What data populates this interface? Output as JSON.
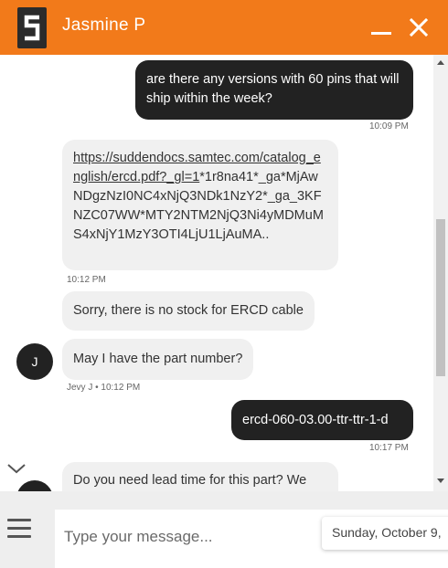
{
  "header": {
    "agent_name": "Jasmine P",
    "colors": {
      "brand": "#f27a1a",
      "logo": "#2b2b2b"
    },
    "icons": {
      "logo": "samtec-s-logo-icon",
      "minimize": "minimize-icon",
      "close": "close-icon"
    }
  },
  "messages": [
    {
      "direction": "outgoing",
      "text": "are there any versions with 60 pins that will ship within the week?",
      "time": "10:09 PM"
    },
    {
      "direction": "incoming",
      "link": "https://suddendocs.samtec.com/catalog_english/ercd.pdf?_gl=1",
      "text_after_link": "*1r8na41*_ga*MjAwNDgzNzI0NC4xNjQ3NDk1NzY2*_ga_3KFNZC07WW*MTY2NTM2NjQ3Ni4yMDMuMS4xNjY1MzY3OTI4LjU1LjAuMA..",
      "time": "10:12 PM"
    },
    {
      "direction": "incoming",
      "text": "Sorry, there is no stock for ERCD cable"
    },
    {
      "direction": "incoming",
      "avatar_initial": "J",
      "text": "May I have the part number?",
      "meta": "Jevy J • 10:12 PM"
    },
    {
      "direction": "outgoing",
      "text": "ercd-060-03.00-ttr-ttr-1-d",
      "time": "10:17 PM"
    },
    {
      "direction": "incoming",
      "text": "Do you need lead time for this part? We"
    }
  ],
  "footer": {
    "input_placeholder": "Type your message...",
    "date_tooltip": "Sunday, October 9,",
    "icons": {
      "menu": "hamburger-menu-icon",
      "scroll_down": "chevron-down-icon"
    }
  }
}
